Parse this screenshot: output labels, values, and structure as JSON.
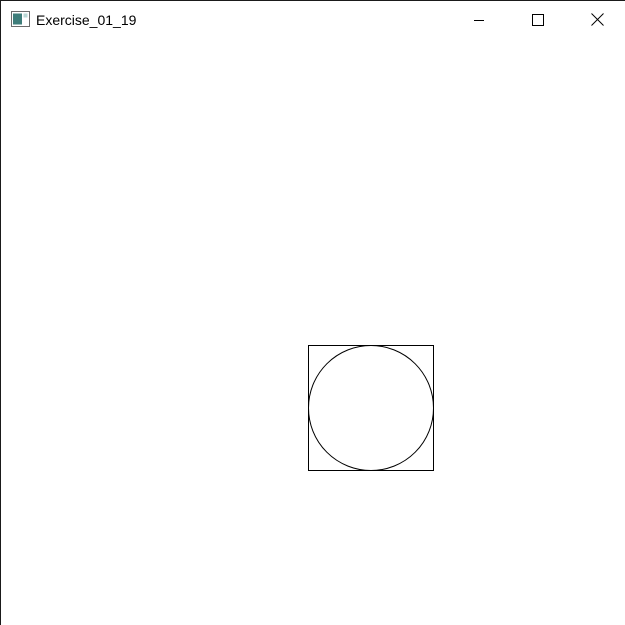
{
  "window": {
    "title": "Exercise_01_19",
    "icon": "java-app-icon",
    "controls": {
      "minimize_icon": "minimize-icon",
      "maximize_icon": "maximize-icon",
      "close_icon": "close-icon"
    }
  },
  "canvas": {
    "background_color": "#ffffff",
    "stroke_color": "#000000",
    "shapes": [
      "square",
      "circle"
    ]
  }
}
